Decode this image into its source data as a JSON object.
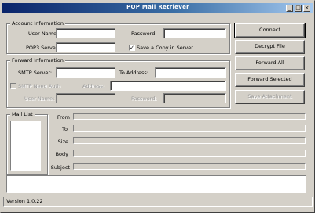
{
  "window": {
    "title": "POP Mail Retriever",
    "controls": [
      "_",
      "□",
      "×"
    ]
  },
  "account_info": {
    "legend": "Account Information",
    "user_name_label": "User Name:",
    "user_name_value": "",
    "password_label": "Password:",
    "password_value": "",
    "pop3_server_label": "POP3 Server:",
    "pop3_server_value": "",
    "save_copy_label": "Save a Copy in Server",
    "save_copy_checked": true
  },
  "forward_info": {
    "legend": "Forward Information",
    "smtp_server_label": "SMTP Server:",
    "smtp_server_value": "",
    "to_address_label": "To Address:",
    "to_address_value": "",
    "smtp_auth_label": "SMTP Need Auth",
    "smtp_auth_checked": false,
    "address_label": "Address:",
    "address_value": "",
    "user_name_label": "User Name:",
    "user_name_value": "",
    "password_label": "Password:",
    "password_value": ""
  },
  "buttons": {
    "connect": "Connect",
    "decrypt_file": "Decrypt File",
    "forward_all": "Forward All",
    "forward_selected": "Forward Selected",
    "save_attachment": "Save Attachment"
  },
  "mail_list": {
    "legend": "Mail List",
    "headers": [
      "From",
      "To",
      "Size",
      "Body",
      "Subject"
    ]
  },
  "status": {
    "text": "Version 1.0.22"
  },
  "colors": {
    "face": "#d4d0c8",
    "title_start": "#0a246a",
    "title_end": "#a6caf0"
  }
}
